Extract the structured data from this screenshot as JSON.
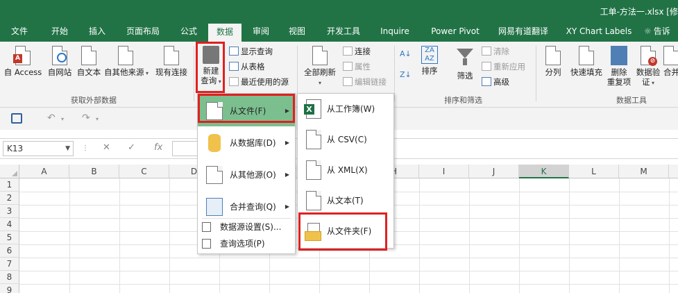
{
  "window": {
    "title": "工单-方法一.xlsx [修"
  },
  "ribbon_tabs": [
    {
      "label": "文件"
    },
    {
      "label": "开始"
    },
    {
      "label": "插入"
    },
    {
      "label": "页面布局"
    },
    {
      "label": "公式"
    },
    {
      "label": "数据"
    },
    {
      "label": "审阅"
    },
    {
      "label": "视图"
    },
    {
      "label": "开发工具"
    },
    {
      "label": "Inquire"
    },
    {
      "label": "Power Pivot"
    },
    {
      "label": "网易有道翻译"
    },
    {
      "label": "XY Chart Labels"
    },
    {
      "label": "告诉"
    }
  ],
  "active_tab": "数据",
  "ribbon": {
    "access": "自 Access",
    "web": "自网站",
    "text": "自文本",
    "other": "自其他来源",
    "existing": "现有连接",
    "new_query_line1": "新建",
    "new_query_line2": "查询",
    "show_queries": "显示查询",
    "from_table": "从表格",
    "recent_sources": "最近使用的源",
    "refresh_all": "全部刷新",
    "connections": "连接",
    "properties": "属性",
    "edit_links": "编辑链接",
    "sort": "排序",
    "filter": "筛选",
    "clear": "清除",
    "reapply": "重新应用",
    "advanced": "高级",
    "split": "分列",
    "flash_fill": "快速填充",
    "remove_dup_line1": "删除",
    "remove_dup_line2": "重复项",
    "validate_line1": "数据验",
    "validate_line2": "证",
    "merge": "合并",
    "group_external": "获取外部数据",
    "group_sort": "排序和筛选",
    "group_tools": "数据工具"
  },
  "formula_bar": {
    "name_box": "K13",
    "fx": "fx"
  },
  "columns": [
    "A",
    "B",
    "C",
    "D",
    "E",
    "F",
    "G",
    "H",
    "I",
    "J",
    "K",
    "L",
    "M"
  ],
  "selected_column": "K",
  "rows": [
    "1",
    "2",
    "3",
    "4",
    "5",
    "6",
    "7",
    "8",
    "9"
  ],
  "menu_new_query": {
    "items": [
      {
        "label": "从文件(F)"
      },
      {
        "label": "从数据库(D)"
      },
      {
        "label": "从其他源(O)"
      },
      {
        "label": "合并查询(Q)"
      }
    ],
    "small_items": [
      {
        "label": "数据源设置(S)..."
      },
      {
        "label": "查询选项(P)"
      }
    ]
  },
  "menu_from_file": {
    "items": [
      {
        "label": "从工作簿(W)"
      },
      {
        "label": "从 CSV(C)"
      },
      {
        "label": "从 XML(X)"
      },
      {
        "label": "从文本(T)"
      },
      {
        "label": "从文件夹(F)"
      }
    ]
  },
  "colors": {
    "accent": "#217346",
    "highlight": "#7cbf8f",
    "annotation": "#e02020"
  }
}
